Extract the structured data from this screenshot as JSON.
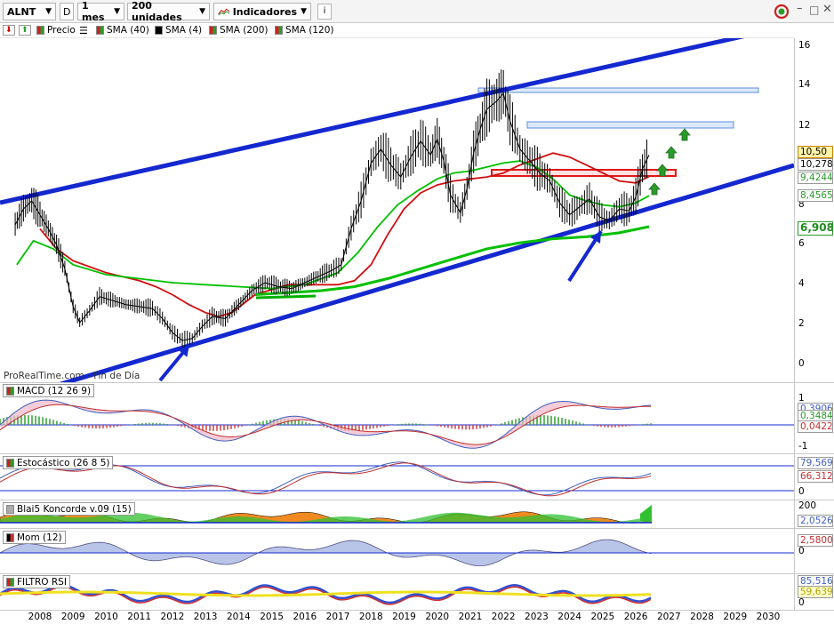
{
  "toolbar": {
    "symbol": "ALNT",
    "d_button": "D",
    "period": "1 mes",
    "units": "200 unidades",
    "indicators": "Indicadores",
    "info_button": "i"
  },
  "legend": [
    {
      "label": "Precio",
      "color": "#00a000"
    },
    {
      "label": "SMA (40)",
      "color": "#d01010"
    },
    {
      "label": "SMA (4)",
      "color": "#000000"
    },
    {
      "label": "SMA (200)",
      "color": "#00c000"
    },
    {
      "label": "SMA (120)",
      "color": "#00c000"
    }
  ],
  "watermark": "ProRealTime.com - Fin de Día",
  "chart_data": [
    {
      "type": "line",
      "title": "ALNT",
      "x_axis_ticks": [
        "2008",
        "2009",
        "2010",
        "2011",
        "2012",
        "2013",
        "2014",
        "2015",
        "2016",
        "2017",
        "2018",
        "2019",
        "2020",
        "2021",
        "2022",
        "2023",
        "2024",
        "2025",
        "2026",
        "2027",
        "2028",
        "2029",
        "2030"
      ],
      "y_axis_ticks": [
        "16",
        "14",
        "12",
        "10",
        "8",
        "6",
        "4",
        "2",
        "0"
      ],
      "ylim": [
        -0.5,
        17.5
      ],
      "xlim": [
        2007.2,
        2030.6
      ],
      "value_labels": {
        "last": "10,50",
        "sma4": "10,278",
        "sma40": "9,4244",
        "sma120": "8,4565",
        "sma200": "6,9083"
      },
      "series": [
        {
          "name": "Precio",
          "color": "#000000",
          "points": [
            [
              2007.25,
              7.0
            ],
            [
              2007.5,
              7.8
            ],
            [
              2007.75,
              8.2
            ],
            [
              2008.0,
              7.5
            ],
            [
              2008.25,
              6.8
            ],
            [
              2008.5,
              6.0
            ],
            [
              2008.75,
              4.8
            ],
            [
              2009.0,
              2.9
            ],
            [
              2009.2,
              2.1
            ],
            [
              2009.5,
              2.7
            ],
            [
              2009.8,
              3.4
            ],
            [
              2010.2,
              3.2
            ],
            [
              2010.6,
              3.0
            ],
            [
              2011.0,
              2.9
            ],
            [
              2011.4,
              2.8
            ],
            [
              2011.7,
              2.3
            ],
            [
              2012.0,
              1.6
            ],
            [
              2012.3,
              1.2
            ],
            [
              2012.6,
              1.3
            ],
            [
              2012.9,
              1.9
            ],
            [
              2013.2,
              2.4
            ],
            [
              2013.6,
              2.3
            ],
            [
              2014.0,
              3.0
            ],
            [
              2014.4,
              3.7
            ],
            [
              2014.8,
              4.1
            ],
            [
              2015.2,
              3.9
            ],
            [
              2015.6,
              3.8
            ],
            [
              2016.0,
              4.1
            ],
            [
              2016.4,
              4.4
            ],
            [
              2016.8,
              4.7
            ],
            [
              2017.1,
              5.0
            ],
            [
              2017.4,
              6.8
            ],
            [
              2017.7,
              8.2
            ],
            [
              2018.0,
              10.1
            ],
            [
              2018.3,
              10.8
            ],
            [
              2018.6,
              10.0
            ],
            [
              2018.9,
              9.4
            ],
            [
              2019.2,
              10.4
            ],
            [
              2019.5,
              11.2
            ],
            [
              2019.8,
              10.5
            ],
            [
              2020.0,
              11.3
            ],
            [
              2020.2,
              10.2
            ],
            [
              2020.4,
              8.5
            ],
            [
              2020.7,
              7.6
            ],
            [
              2020.9,
              8.8
            ],
            [
              2021.1,
              10.6
            ],
            [
              2021.3,
              11.8
            ],
            [
              2021.5,
              12.8
            ],
            [
              2021.8,
              13.2
            ],
            [
              2022.0,
              13.6
            ],
            [
              2022.2,
              12.2
            ],
            [
              2022.5,
              10.8
            ],
            [
              2022.8,
              10.2
            ],
            [
              2023.1,
              9.6
            ],
            [
              2023.4,
              9.2
            ],
            [
              2023.7,
              8.1
            ],
            [
              2024.0,
              7.5
            ],
            [
              2024.3,
              7.9
            ],
            [
              2024.6,
              8.3
            ],
            [
              2024.9,
              7.4
            ],
            [
              2025.2,
              7.2
            ],
            [
              2025.5,
              7.8
            ],
            [
              2025.8,
              7.7
            ],
            [
              2026.0,
              8.4
            ],
            [
              2026.2,
              9.8
            ],
            [
              2026.4,
              10.5
            ]
          ]
        },
        {
          "name": "SMA (40)",
          "color": "#d01010",
          "points": [
            [
              2008.0,
              6.8
            ],
            [
              2008.5,
              5.8
            ],
            [
              2009.0,
              5.2
            ],
            [
              2009.5,
              4.9
            ],
            [
              2010.0,
              4.6
            ],
            [
              2010.5,
              4.4
            ],
            [
              2011.0,
              4.2
            ],
            [
              2011.5,
              3.9
            ],
            [
              2012.0,
              3.5
            ],
            [
              2012.5,
              3.0
            ],
            [
              2013.0,
              2.6
            ],
            [
              2013.4,
              2.4
            ],
            [
              2013.8,
              2.6
            ],
            [
              2014.5,
              3.5
            ],
            [
              2015.5,
              4.0
            ],
            [
              2016.5,
              4.0
            ],
            [
              2017.0,
              4.0
            ],
            [
              2017.5,
              4.2
            ],
            [
              2018.0,
              5.0
            ],
            [
              2018.5,
              6.5
            ],
            [
              2019.0,
              7.8
            ],
            [
              2019.5,
              8.6
            ],
            [
              2020.0,
              9.0
            ],
            [
              2020.5,
              9.2
            ],
            [
              2021.0,
              9.3
            ],
            [
              2021.5,
              9.4
            ],
            [
              2022.0,
              9.6
            ],
            [
              2022.5,
              10.0
            ],
            [
              2023.0,
              10.3
            ],
            [
              2023.5,
              10.6
            ],
            [
              2024.0,
              10.4
            ],
            [
              2024.5,
              10.0
            ],
            [
              2025.0,
              9.6
            ],
            [
              2025.5,
              9.2
            ],
            [
              2026.0,
              9.1
            ],
            [
              2026.4,
              9.42
            ]
          ]
        },
        {
          "name": "SMA (120)",
          "color": "#00c000",
          "points": [
            [
              2007.3,
              5.0
            ],
            [
              2007.8,
              6.2
            ],
            [
              2008.4,
              5.8
            ],
            [
              2009.0,
              5.0
            ],
            [
              2010.0,
              4.5
            ],
            [
              2011.0,
              4.3
            ],
            [
              2012.0,
              4.1
            ],
            [
              2013.0,
              4.0
            ],
            [
              2014.0,
              3.9
            ],
            [
              2015.0,
              3.8
            ],
            [
              2016.0,
              4.0
            ],
            [
              2017.0,
              4.6
            ],
            [
              2017.6,
              5.6
            ],
            [
              2018.2,
              6.9
            ],
            [
              2018.8,
              8.0
            ],
            [
              2019.4,
              8.7
            ],
            [
              2020.0,
              9.3
            ],
            [
              2020.5,
              9.6
            ],
            [
              2021.0,
              9.7
            ],
            [
              2021.5,
              9.9
            ],
            [
              2022.0,
              10.1
            ],
            [
              2022.5,
              10.2
            ],
            [
              2023.0,
              9.9
            ],
            [
              2023.5,
              9.3
            ],
            [
              2024.0,
              8.5
            ],
            [
              2024.5,
              8.2
            ],
            [
              2025.0,
              8.0
            ],
            [
              2025.5,
              7.9
            ],
            [
              2026.0,
              8.1
            ],
            [
              2026.4,
              8.46
            ]
          ]
        },
        {
          "name": "SMA (200)",
          "color": "#00c000",
          "points": [
            [
              2014.5,
              3.5
            ],
            [
              2015.5,
              3.6
            ],
            [
              2016.5,
              3.7
            ],
            [
              2017.5,
              3.9
            ],
            [
              2018.5,
              4.3
            ],
            [
              2019.5,
              4.8
            ],
            [
              2020.5,
              5.3
            ],
            [
              2021.5,
              5.8
            ],
            [
              2022.5,
              6.1
            ],
            [
              2023.5,
              6.3
            ],
            [
              2024.5,
              6.4
            ],
            [
              2025.5,
              6.6
            ],
            [
              2026.4,
              6.91
            ]
          ]
        }
      ]
    },
    {
      "type": "line",
      "title": "MACD (12 26 9)",
      "y_axis_ticks": [
        "1",
        "0",
        "-1"
      ],
      "ylim": [
        -1.1,
        1.3
      ],
      "value_labels": [
        "0,3906",
        "0,3484",
        "0,0422"
      ]
    },
    {
      "type": "line",
      "title": "Estocástico (26 8 5)",
      "y_axis_ticks": [
        "100",
        "0"
      ],
      "ylim": [
        -5,
        110
      ],
      "value_labels": [
        "79,569",
        "66,312"
      ]
    },
    {
      "type": "area",
      "title": "Blai5 Koncorde v.09 (15)",
      "y_axis_ticks": [
        "200",
        "0"
      ],
      "value_labels": [
        "2,0526"
      ]
    },
    {
      "type": "area",
      "title": "Mom (12)",
      "y_axis_ticks": [
        "0"
      ],
      "value_labels": [
        "2,5800"
      ]
    },
    {
      "type": "line",
      "title": "FILTRO RSI",
      "y_axis_ticks": [
        "100",
        "0"
      ],
      "ylim": [
        -5,
        110
      ],
      "value_labels": [
        "85,516",
        "59,639"
      ]
    }
  ],
  "colors": {
    "channel": "#1428d0",
    "resistance_zone": "#5a8ee0",
    "support_zone": "#e01818",
    "arrow": "#2a9a2a"
  }
}
